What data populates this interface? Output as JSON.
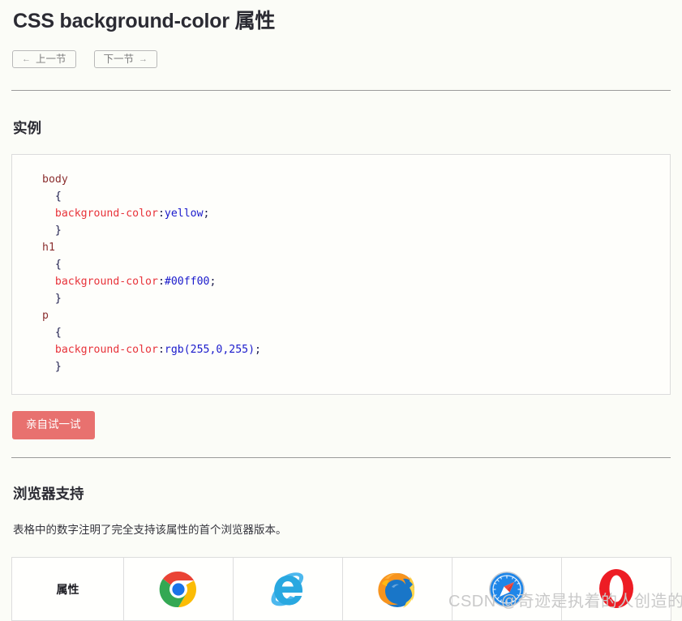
{
  "page": {
    "title": "CSS background-color 属性",
    "background_color": "#fbfcf7"
  },
  "nav": {
    "prev": {
      "label": "上一节",
      "arrow": "←"
    },
    "next": {
      "label": "下一节",
      "arrow": "→"
    }
  },
  "example_section": {
    "heading": "实例",
    "code_lines": [
      {
        "selector": "body"
      },
      {
        "brace": "{"
      },
      {
        "prop": "background-color",
        "colon": ":",
        "value": "yellow",
        "semi": ";"
      },
      {
        "brace": "}"
      },
      {
        "selector": "h1"
      },
      {
        "brace": "{"
      },
      {
        "prop": "background-color",
        "colon": ":",
        "value": "#00ff00",
        "semi": ";"
      },
      {
        "brace": "}"
      },
      {
        "selector": "p"
      },
      {
        "brace": "{"
      },
      {
        "prop": "background-color",
        "colon": ":",
        "value": "rgb(255,0,255)",
        "semi": ";"
      },
      {
        "brace": "}"
      }
    ],
    "code_text": "body\n  {\n  background-color:yellow;\n  }\nh1\n  {\n  background-color:#00ff00;\n  }\np\n  {\n  background-color:rgb(255,0,255);\n  }",
    "try_button_label": "亲自试一试",
    "try_button_color": "#e8716f"
  },
  "browser_section": {
    "heading": "浏览器支持",
    "description": "表格中的数字注明了完全支持该属性的首个浏览器版本。",
    "table": {
      "columns": [
        {
          "label": "属性",
          "icon": "none"
        },
        {
          "label": "",
          "icon": "chrome-icon"
        },
        {
          "label": "",
          "icon": "internet-explorer-icon"
        },
        {
          "label": "",
          "icon": "firefox-icon"
        },
        {
          "label": "",
          "icon": "safari-icon"
        },
        {
          "label": "",
          "icon": "opera-icon"
        }
      ]
    }
  },
  "watermark": {
    "text": "CSDN @奇迹是执着的人创造的",
    "color": "#c9c9c9"
  }
}
